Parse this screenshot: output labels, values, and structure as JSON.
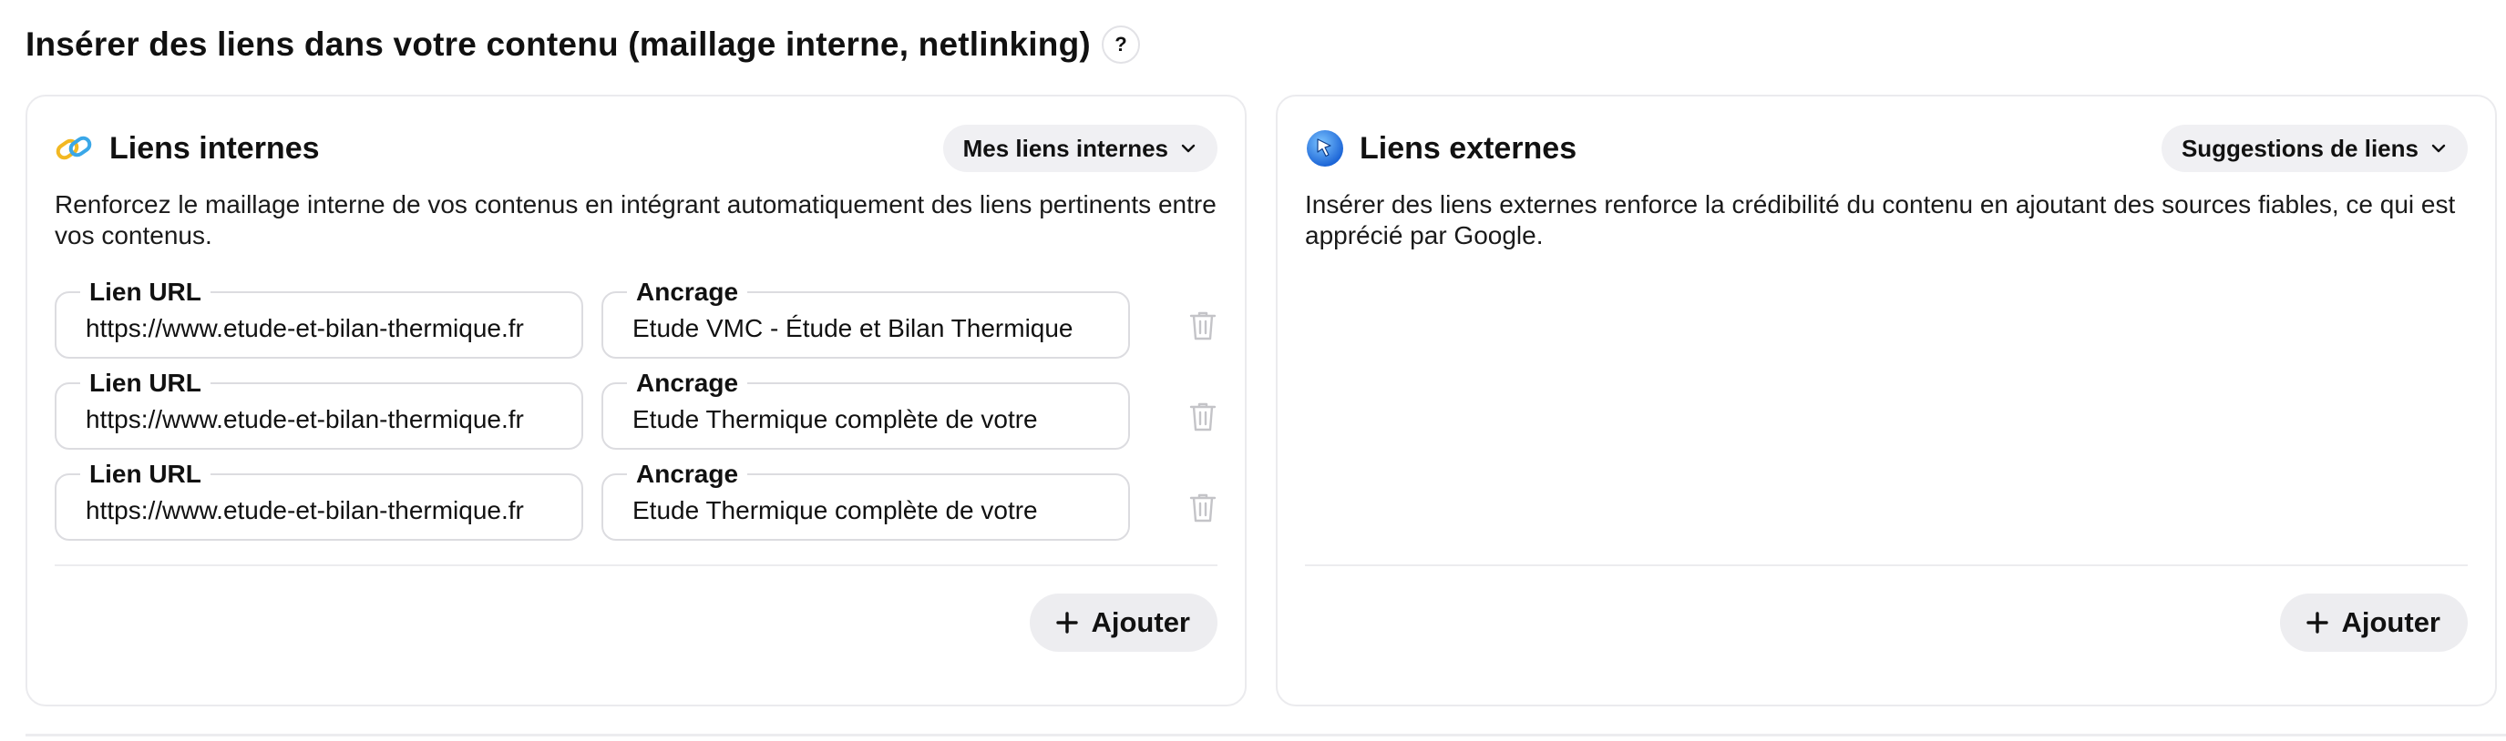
{
  "page": {
    "title": "Insérer des liens dans votre contenu (maillage interne, netlinking)",
    "help_label": "?"
  },
  "internal": {
    "icon": "link-chain-icon",
    "title": "Liens internes",
    "select_label": "Mes liens internes",
    "description": "Renforcez le maillage interne de vos contenus en intégrant automatiquement des liens pertinents entre vos contenus.",
    "url_label": "Lien URL",
    "anchor_label": "Ancrage",
    "links": [
      {
        "url": "https://www.etude-et-bilan-thermique.fr",
        "anchor": "Etude VMC - Étude et Bilan Thermique"
      },
      {
        "url": "https://www.etude-et-bilan-thermique.fr",
        "anchor": "Etude Thermique complète de votre"
      },
      {
        "url": "https://www.etude-et-bilan-thermique.fr",
        "anchor": "Etude Thermique complète de votre"
      }
    ],
    "add_label": "Ajouter"
  },
  "external": {
    "icon": "globe-cursor-icon",
    "title": "Liens externes",
    "select_label": "Suggestions de liens",
    "description": "Insérer des liens externes renforce la crédibilité du contenu en ajoutant des sources fiables, ce qui est apprécié par Google.",
    "add_label": "Ajouter"
  },
  "colors": {
    "text": "#111111",
    "border": "#ebebee",
    "pill_bg": "#f0f0f3",
    "trash": "#c4c4c8"
  }
}
